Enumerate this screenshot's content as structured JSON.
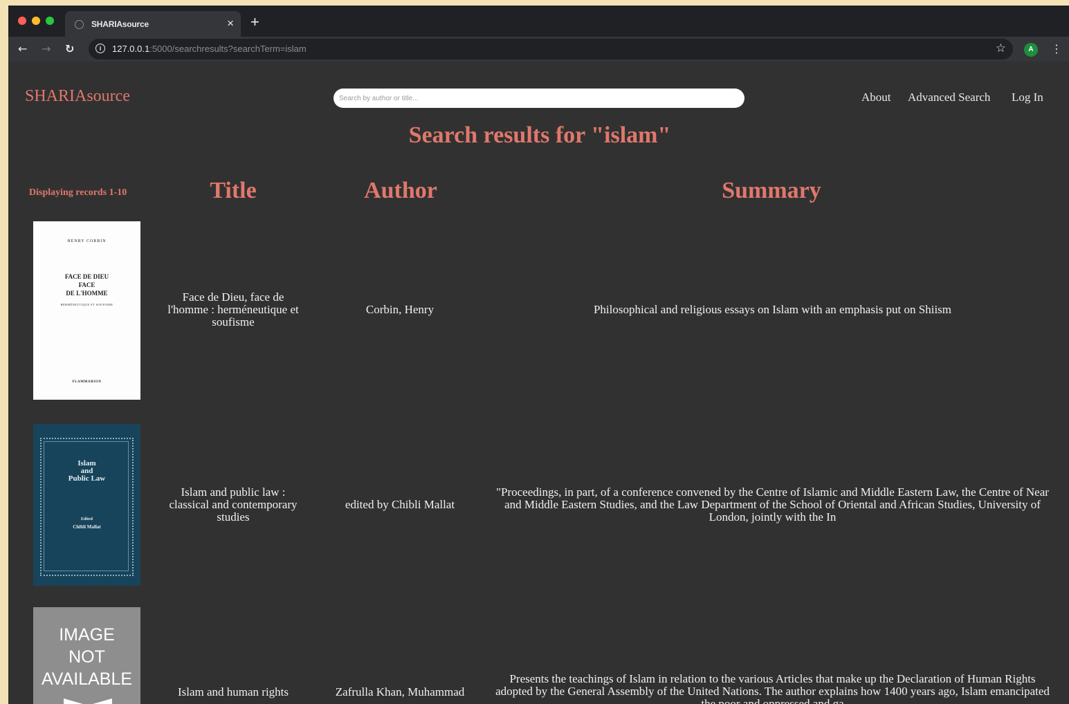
{
  "browser": {
    "tab_title": "SHARIAsource",
    "tab_close": "×",
    "new_tab": "+",
    "url_host": "127.0.0.1",
    "url_rest": ":5000/searchresults?searchTerm=islam",
    "profile_initial": "A"
  },
  "header": {
    "brand": "SHARIAsource",
    "search_placeholder": "Search by author or title...",
    "nav": {
      "about": "About",
      "advanced_search": "Advanced Search",
      "log_in": "Log In"
    }
  },
  "results": {
    "heading": "Search results for \"islam\"",
    "records_label": "Displaying records 1-10",
    "columns": {
      "title": "Title",
      "author": "Author",
      "summary": "Summary"
    },
    "rows": [
      {
        "title": "Face de Dieu, face de l'homme : herméneutique et soufisme",
        "author": "Corbin, Henry",
        "summary": "Philosophical and religious essays on Islam with an emphasis put on Shiism",
        "cover": {
          "author_line": "HENRY CORBIN",
          "title_lines": [
            "FACE DE DIEU",
            "FACE",
            "DE L'HOMME"
          ],
          "subtitle": "HERMÉNEUTIQUE ET SOUFISME",
          "publisher": "FLAMMARION"
        }
      },
      {
        "title": "Islam and public law : classical and contemporary studies",
        "author": "edited by Chibli Mallat",
        "summary": "\"Proceedings, in part, of a conference convened by the Centre of Islamic and Middle Eastern Law, the Centre of Near and Middle Eastern Studies, and the Law Department of the School of Oriental and African Studies, University of London, jointly with the In",
        "cover": {
          "title_lines": [
            "Islam",
            "and",
            "Public Law"
          ],
          "editor_label": "Edited",
          "editor": "Chibli Mallat"
        }
      },
      {
        "title": "Islam and human rights",
        "author": "Zafrulla Khan, Muhammad",
        "summary": "Presents the teachings of Islam in relation to the various Articles that make up the Declaration of Human Rights adopted by the General Assembly of the United Nations. The author explains how 1400 years ago, Islam emancipated the poor and oppressed and ga",
        "cover": {
          "placeholder_lines": [
            "IMAGE",
            "NOT",
            "AVAILABLE"
          ]
        }
      }
    ]
  },
  "colors": {
    "accent": "#e0786c",
    "page_bg": "#323131",
    "text": "#f1f1f1"
  }
}
